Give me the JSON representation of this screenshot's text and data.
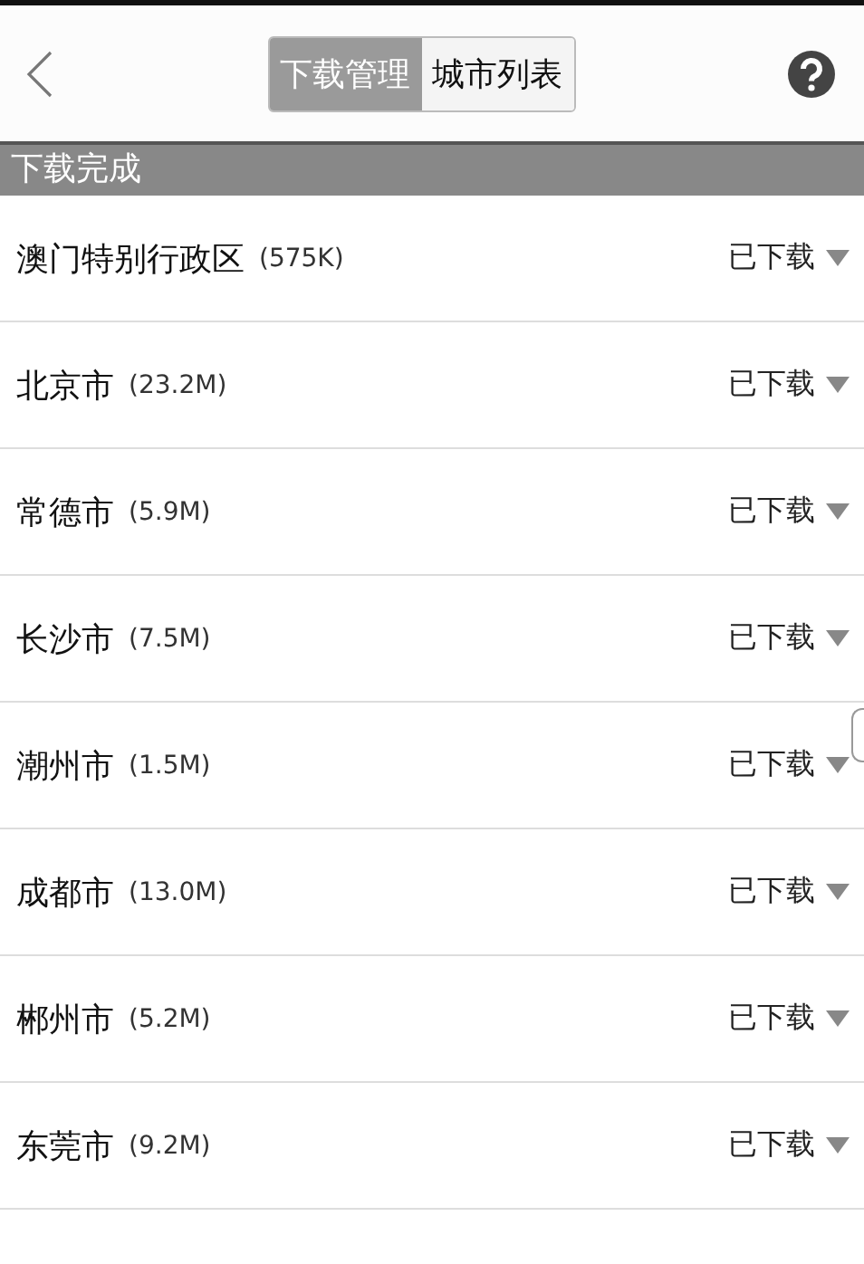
{
  "header": {
    "tabs": [
      {
        "label": "下载管理",
        "selected": true
      },
      {
        "label": "城市列表",
        "selected": false
      }
    ]
  },
  "section": {
    "title": "下载完成"
  },
  "cities": [
    {
      "name": "澳门特别行政区",
      "size": "(575K)",
      "status": "已下载"
    },
    {
      "name": "北京市",
      "size": "(23.2M)",
      "status": "已下载"
    },
    {
      "name": "常德市",
      "size": "(5.9M)",
      "status": "已下载"
    },
    {
      "name": "长沙市",
      "size": "(7.5M)",
      "status": "已下载"
    },
    {
      "name": "潮州市",
      "size": "(1.5M)",
      "status": "已下载"
    },
    {
      "name": "成都市",
      "size": "(13.0M)",
      "status": "已下载"
    },
    {
      "name": "郴州市",
      "size": "(5.2M)",
      "status": "已下载"
    },
    {
      "name": "东莞市",
      "size": "(9.2M)",
      "status": "已下载"
    }
  ]
}
